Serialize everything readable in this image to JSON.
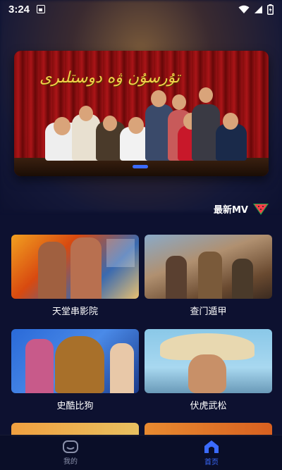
{
  "status_bar": {
    "time": "3:24",
    "icons": [
      "notification-icon",
      "wifi-icon",
      "signal-icon",
      "battery-icon"
    ]
  },
  "banner": {
    "title": "تۇرسۇن ۋە دوستلىرى",
    "active_index": 0
  },
  "section": {
    "label": "最新MV",
    "icon": "watermelon-icon"
  },
  "movies": [
    {
      "title": "天堂串影院"
    },
    {
      "title": "查门遁甲"
    },
    {
      "title": "史酷比狗"
    },
    {
      "title": "伏虎武松"
    }
  ],
  "nav": {
    "mine_label": "我的",
    "home_label": "首页"
  },
  "colors": {
    "background": "#0d1130",
    "accent": "#3b6bff"
  }
}
